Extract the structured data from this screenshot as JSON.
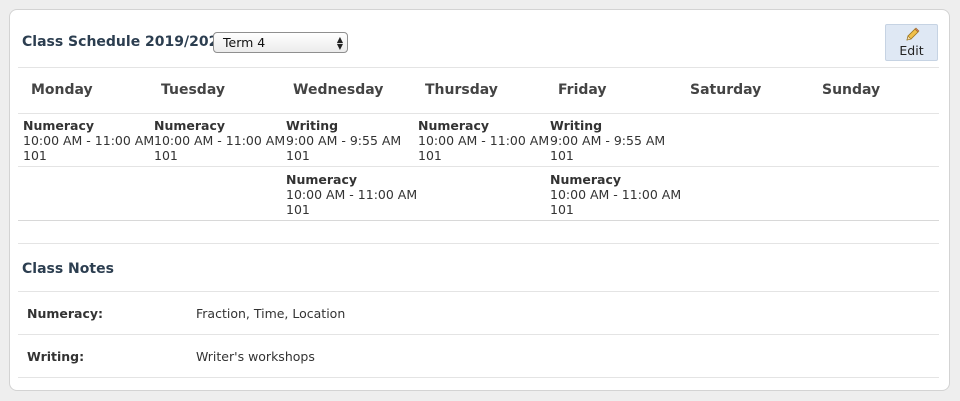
{
  "header": {
    "title": "Class Schedule 2019/2020",
    "term_selected": "Term 4",
    "edit_label": "Edit",
    "edit_icon": "pencil-icon",
    "select_icon": "up-down-arrows-icon"
  },
  "days": [
    "Monday",
    "Tuesday",
    "Wednesday",
    "Thursday",
    "Friday",
    "Saturday",
    "Sunday"
  ],
  "schedule": {
    "monday": [
      {
        "subject": "Numeracy",
        "time": "10:00 AM - 11:00 AM",
        "room": "101"
      }
    ],
    "tuesday": [
      {
        "subject": "Numeracy",
        "time": "10:00 AM - 11:00 AM",
        "room": "101"
      }
    ],
    "wednesday": [
      {
        "subject": "Writing",
        "time": "9:00 AM - 9:55 AM",
        "room": "101"
      },
      {
        "subject": "Numeracy",
        "time": "10:00 AM - 11:00 AM",
        "room": "101"
      }
    ],
    "thursday": [
      {
        "subject": "Numeracy",
        "time": "10:00 AM - 11:00 AM",
        "room": "101"
      }
    ],
    "friday": [
      {
        "subject": "Writing",
        "time": "9:00 AM - 9:55 AM",
        "room": "101"
      },
      {
        "subject": "Numeracy",
        "time": "10:00 AM - 11:00 AM",
        "room": "101"
      }
    ],
    "saturday": [],
    "sunday": []
  },
  "notes": {
    "title": "Class Notes",
    "items": [
      {
        "subject": "Numeracy:",
        "text": "Fraction, Time, Location"
      },
      {
        "subject": "Writing:",
        "text": "Writer's workshops"
      }
    ]
  }
}
